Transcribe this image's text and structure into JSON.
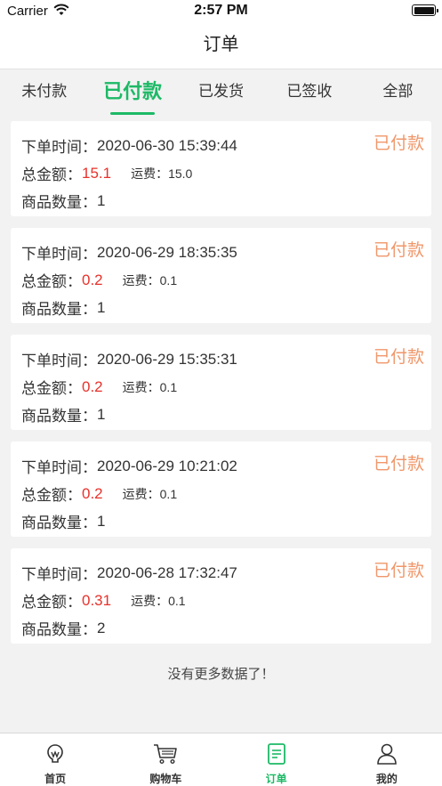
{
  "status_bar": {
    "carrier": "Carrier",
    "time": "2:57 PM"
  },
  "nav": {
    "title": "订单"
  },
  "tabs": [
    {
      "label": "未付款"
    },
    {
      "label": "已付款"
    },
    {
      "label": "已发货"
    },
    {
      "label": "已签收"
    },
    {
      "label": "全部"
    }
  ],
  "labels": {
    "order_time": "下单时间：",
    "total": "总金额：",
    "freight": "运费：",
    "quantity": "商品数量："
  },
  "orders": [
    {
      "time": "2020-06-30 15:39:44",
      "total": "15.1",
      "freight": "15.0",
      "quantity": "1",
      "status": "已付款"
    },
    {
      "time": "2020-06-29 18:35:35",
      "total": "0.2",
      "freight": "0.1",
      "quantity": "1",
      "status": "已付款"
    },
    {
      "time": "2020-06-29 15:35:31",
      "total": "0.2",
      "freight": "0.1",
      "quantity": "1",
      "status": "已付款"
    },
    {
      "time": "2020-06-29 10:21:02",
      "total": "0.2",
      "freight": "0.1",
      "quantity": "1",
      "status": "已付款"
    },
    {
      "time": "2020-06-28 17:32:47",
      "total": "0.31",
      "freight": "0.1",
      "quantity": "2",
      "status": "已付款"
    }
  ],
  "footer_text": "没有更多数据了！",
  "tab_bar": [
    {
      "label": "首页",
      "icon": "home-icon"
    },
    {
      "label": "购物车",
      "icon": "cart-icon"
    },
    {
      "label": "订单",
      "icon": "order-icon"
    },
    {
      "label": "我的",
      "icon": "profile-icon"
    }
  ],
  "colors": {
    "accent": "#1db966",
    "price": "#e8322b",
    "status": "#f0976a"
  }
}
